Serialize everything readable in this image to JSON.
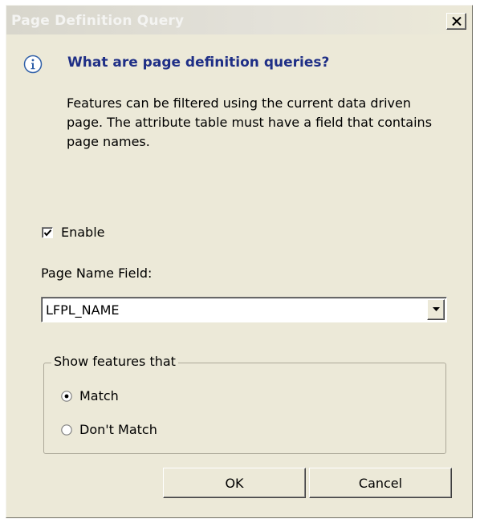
{
  "window": {
    "title": "Page Definition Query"
  },
  "info": {
    "icon": "info-icon",
    "heading": "What are page definition queries?",
    "description": "Features can be filtered using the current data driven page.  The attribute table must have a field that contains page names."
  },
  "enable": {
    "label": "Enable",
    "checked": true
  },
  "page_name_field": {
    "label": "Page Name Field:",
    "value": "LFPL_NAME"
  },
  "show_features": {
    "title": "Show features that",
    "options": [
      {
        "label": "Match",
        "selected": true
      },
      {
        "label": "Don't Match",
        "selected": false
      }
    ]
  },
  "buttons": {
    "ok": "OK",
    "cancel": "Cancel"
  },
  "colors": {
    "dialog_bg": "#ece9d8",
    "heading": "#1f2f86",
    "info_icon": "#2f5fa8"
  }
}
